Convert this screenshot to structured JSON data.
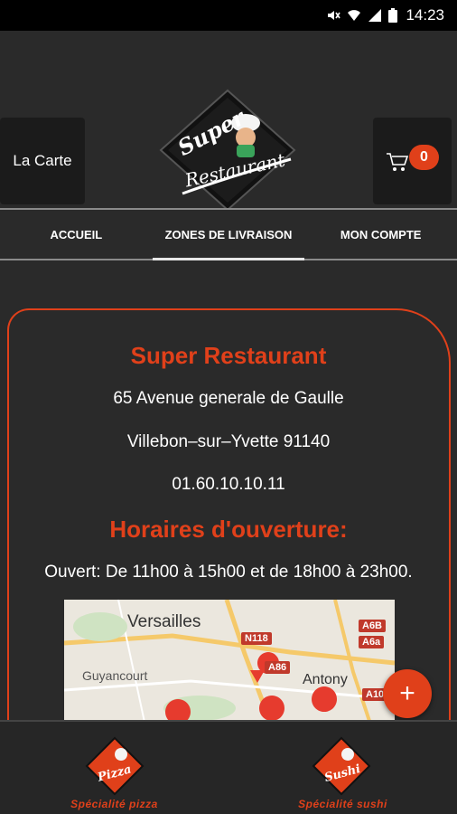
{
  "status_bar": {
    "time": "14:23"
  },
  "header": {
    "menu_label": "La Carte",
    "cart_count": "0",
    "logo_line1": "Super",
    "logo_line2": "Restaurant"
  },
  "tabs": [
    {
      "label": "ACCUEIL"
    },
    {
      "label": "ZONES DE LIVRAISON"
    },
    {
      "label": "MON COMPTE"
    }
  ],
  "restaurant": {
    "name": "Super Restaurant",
    "address": "65 Avenue generale de Gaulle",
    "city": "Villebon–sur–Yvette 91140",
    "phone": "01.60.10.10.11"
  },
  "hours": {
    "title": "Horaires d'ouverture:",
    "text": "Ouvert: De 11h00 à 15h00 et de 18h00 à 23h00."
  },
  "map": {
    "labels": [
      "Versailles",
      "Guyancourt",
      "Antony"
    ],
    "roads": [
      "N118",
      "A86",
      "A6B",
      "A6a",
      "A10"
    ]
  },
  "fab_label": "+",
  "bottom_nav": [
    {
      "label": "Spécialité pizza",
      "logo_word": "Pizza"
    },
    {
      "label": "Spécialité sushi",
      "logo_word": "Sushi"
    }
  ],
  "colors": {
    "accent": "#e0401a",
    "background": "#2a2a2a"
  }
}
